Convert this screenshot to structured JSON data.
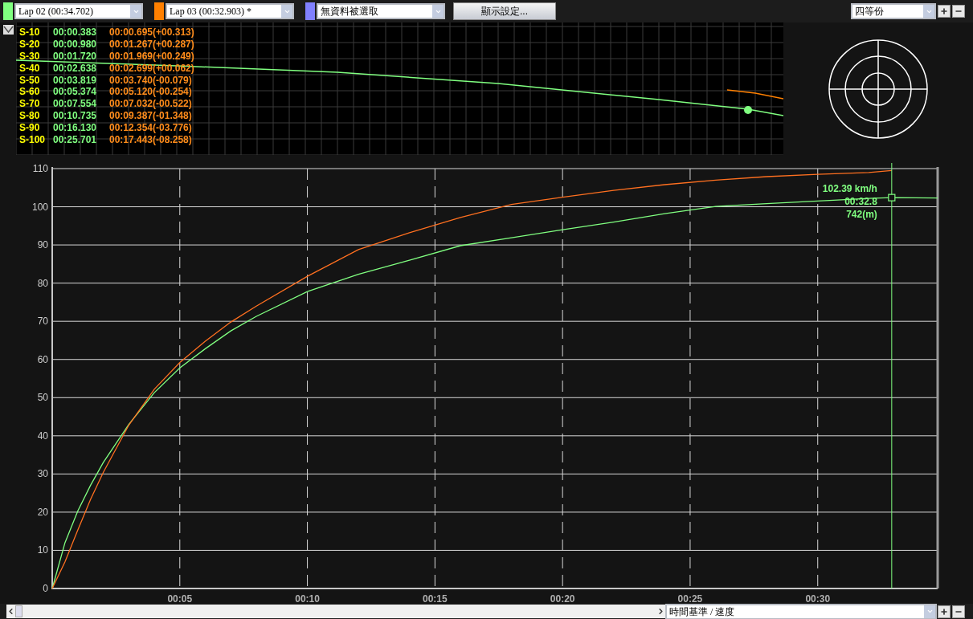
{
  "toolbar": {
    "laps": [
      {
        "color": "#80ff80",
        "value": "Lap 02   (00:34.702)"
      },
      {
        "color": "#ff8000",
        "value": "Lap 03   (00:32.903) *"
      },
      {
        "color": "#8080ff",
        "value": "無資料被選取"
      }
    ],
    "settings_button": "顯示設定...",
    "division_select": {
      "value": "四等份"
    }
  },
  "splits": {
    "rows": [
      {
        "label": "S-10",
        "time_a": "00:00.383",
        "time_b": "00:00.695(+00.313)"
      },
      {
        "label": "S-20",
        "time_a": "00:00.980",
        "time_b": "00:01.267(+00.287)"
      },
      {
        "label": "S-30",
        "time_a": "00:01.720",
        "time_b": "00:01.969(+00.249)"
      },
      {
        "label": "S-40",
        "time_a": "00:02.638",
        "time_b": "00:02.699(+00.062)"
      },
      {
        "label": "S-50",
        "time_a": "00:03.819",
        "time_b": "00:03.740(-00.079)"
      },
      {
        "label": "S-60",
        "time_a": "00:05.374",
        "time_b": "00:05.120(-00.254)"
      },
      {
        "label": "S-70",
        "time_a": "00:07.554",
        "time_b": "00:07.032(-00.522)"
      },
      {
        "label": "S-80",
        "time_a": "00:10.735",
        "time_b": "00:09.387(-01.348)"
      },
      {
        "label": "S-90",
        "time_a": "00:16.130",
        "time_b": "00:12.354(-03.776)"
      },
      {
        "label": "S-100",
        "time_a": "00:25.701",
        "time_b": "00:17.443(-08.258)"
      }
    ]
  },
  "chart": {
    "chart_data": {
      "type": "line",
      "x": [
        0,
        0.5,
        1,
        1.5,
        2,
        3,
        4,
        5,
        6,
        7,
        8,
        10,
        12,
        14,
        16,
        18,
        20,
        22,
        24,
        26,
        28,
        30,
        32,
        32.9,
        34.7
      ],
      "series": [
        {
          "color": "#80ff80",
          "values": [
            0,
            12,
            20.3,
            27,
            33,
            43,
            51.3,
            57.8,
            62.8,
            67.5,
            71.3,
            77.8,
            82.3,
            86,
            89.8,
            91.9,
            94,
            96,
            98.2,
            100.1,
            100.8,
            101.5,
            102.2,
            102.4,
            102.3
          ]
        },
        {
          "color": "#ff7020",
          "values": [
            0,
            7,
            15.3,
            23.3,
            30.4,
            42.8,
            52.2,
            59.2,
            64.8,
            69.8,
            74,
            81.8,
            88.8,
            93.2,
            97.2,
            100.6,
            102.5,
            104.3,
            105.8,
            107,
            107.9,
            108.5,
            109,
            109.5,
            null
          ]
        }
      ],
      "xlim": [
        0,
        34.7
      ],
      "ylim": [
        0,
        110
      ],
      "xticks": [
        {
          "value": 5,
          "label": "00:05"
        },
        {
          "value": 10,
          "label": "00:10"
        },
        {
          "value": 15,
          "label": "00:15"
        },
        {
          "value": 20,
          "label": "00:20"
        },
        {
          "value": 25,
          "label": "00:25"
        },
        {
          "value": 30,
          "label": "00:30"
        }
      ],
      "yticks": [
        0,
        10,
        20,
        30,
        40,
        50,
        60,
        70,
        80,
        90,
        100,
        110
      ],
      "grid": true,
      "ref_lines": [
        {
          "axis": "x",
          "value": 32.9,
          "color": "#80ff80"
        }
      ]
    },
    "cursor": {
      "speed": "102.39 km/h",
      "time": "00:32.8",
      "distance": "742(m)"
    }
  },
  "bottom_bar": {
    "axis_select": {
      "value": "時間基準 / 速度"
    }
  }
}
